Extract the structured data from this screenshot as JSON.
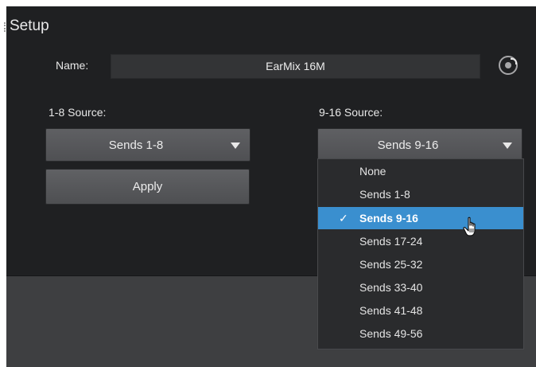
{
  "panel": {
    "title": "Setup"
  },
  "name": {
    "label": "Name:",
    "value": "EarMix 16M"
  },
  "source_1_8": {
    "label": "1-8 Source:",
    "selected": "Sends 1-8"
  },
  "source_9_16": {
    "label": "9-16 Source:",
    "selected": "Sends 9-16"
  },
  "apply_label": "Apply",
  "menu": {
    "items": [
      "None",
      "Sends 1-8",
      "Sends 9-16",
      "Sends 17-24",
      "Sends 25-32",
      "Sends 33-40",
      "Sends 41-48",
      "Sends 49-56"
    ],
    "selected_index": 2,
    "check_glyph": "✓"
  },
  "icons": {
    "settings": "settings-dial-icon",
    "cursor": "hand-pointer-icon",
    "dropdown": "triangle-down-icon"
  },
  "colors": {
    "panel_bg": "#1f2022",
    "highlight": "#3a8fcf",
    "button": "#57585b"
  }
}
